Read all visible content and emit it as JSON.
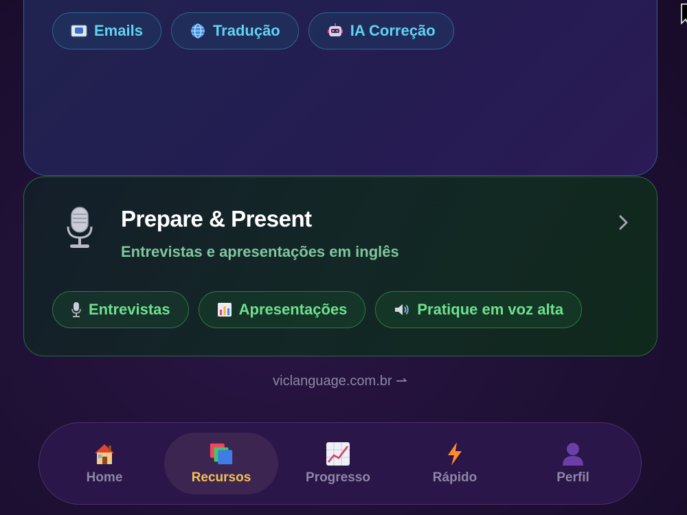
{
  "top_card": {
    "chips": [
      {
        "label": "Emails",
        "icon": "envelope-icon"
      },
      {
        "label": "Tradução",
        "icon": "globe-icon"
      },
      {
        "label": "IA Correção",
        "icon": "robot-icon"
      }
    ]
  },
  "prepare_card": {
    "icon": "microphone-icon",
    "title": "Prepare & Present",
    "subtitle": "Entrevistas e apresentações em inglês",
    "chips": [
      {
        "label": "Entrevistas",
        "icon": "microphone-icon"
      },
      {
        "label": "Apresentações",
        "icon": "bar-chart-icon"
      },
      {
        "label": "Pratique em voz alta",
        "icon": "speaker-icon"
      }
    ]
  },
  "footer": {
    "link": "viclanguage.com.br ⇀"
  },
  "nav": {
    "items": [
      {
        "label": "Home",
        "icon": "house-icon",
        "active": false
      },
      {
        "label": "Recursos",
        "icon": "stacked-cards-icon",
        "active": true
      },
      {
        "label": "Progresso",
        "icon": "line-chart-icon",
        "active": false
      },
      {
        "label": "Rápido",
        "icon": "lightning-icon",
        "active": false
      },
      {
        "label": "Perfil",
        "icon": "user-icon",
        "active": false
      }
    ]
  },
  "colors": {
    "accent_blue": "#5fd4ee",
    "accent_green": "#6fe08f",
    "active_nav": "#f3c24f"
  }
}
